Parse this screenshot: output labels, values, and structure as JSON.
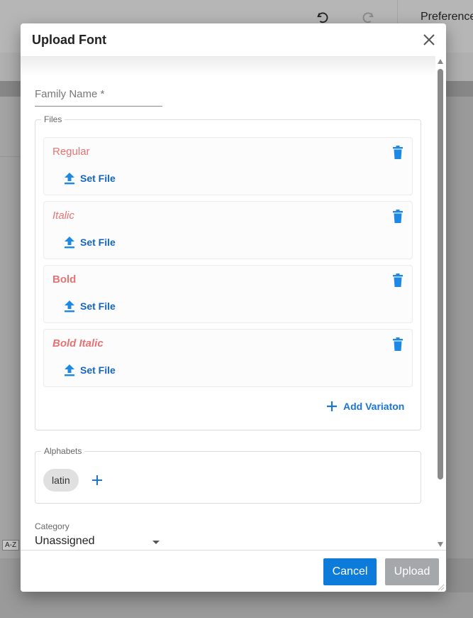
{
  "background": {
    "undo_icon": "undo-icon",
    "redo_icon": "redo-icon",
    "preferences_label": "Preference",
    "az_label": "A-Z"
  },
  "dialog": {
    "title": "Upload Font",
    "close_icon": "close-icon",
    "family_name": {
      "placeholder": "Family Name *",
      "value": ""
    },
    "files": {
      "legend": "Files",
      "variations": [
        {
          "name": "Regular",
          "set_file_label": "Set File"
        },
        {
          "name": "Italic",
          "set_file_label": "Set File"
        },
        {
          "name": "Bold",
          "set_file_label": "Set File"
        },
        {
          "name": "Bold Italic",
          "set_file_label": "Set File"
        }
      ],
      "add_variation_label": "Add Variaton"
    },
    "alphabets": {
      "legend": "Alphabets",
      "chips": [
        "latin"
      ]
    },
    "category": {
      "label": "Category",
      "value": "Unassigned"
    },
    "footer": {
      "cancel_label": "Cancel",
      "upload_label": "Upload"
    },
    "colors": {
      "accent": "#0d7bd9",
      "variation_name": "#e57373",
      "disabled_button": "#a5a8ab"
    }
  }
}
